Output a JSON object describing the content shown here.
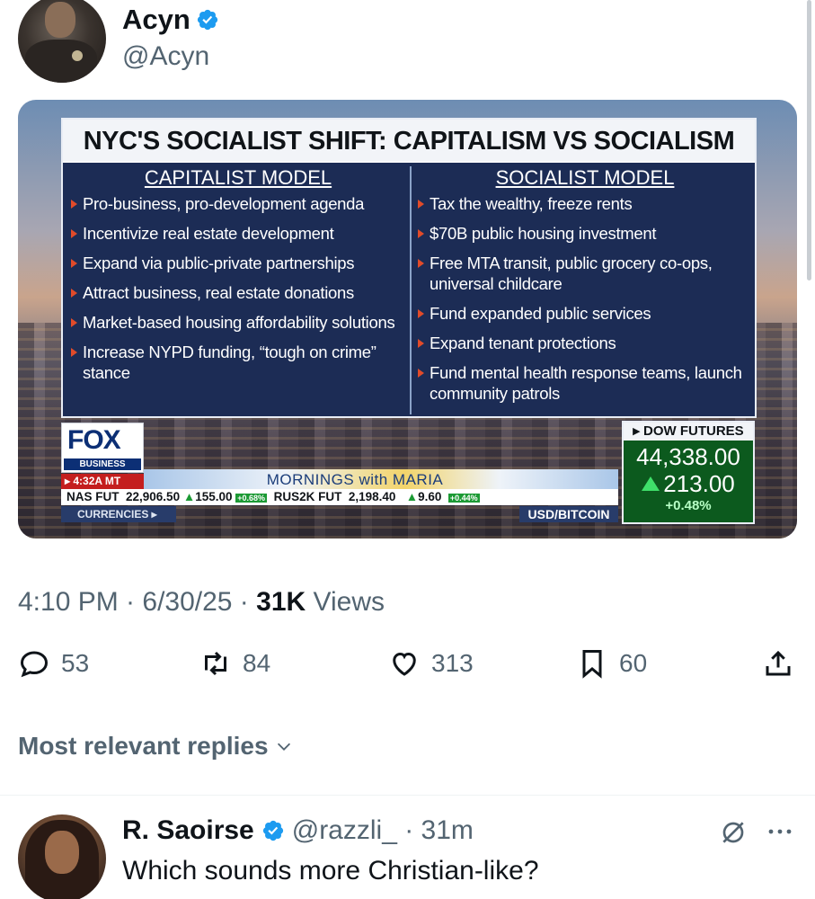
{
  "tweet": {
    "author": {
      "name": "Acyn",
      "handle": "@Acyn"
    },
    "media": {
      "title": "NYC'S SOCIALIST SHIFT: CAPITALISM VS SOCIALISM",
      "left_heading": "CAPITALIST MODEL",
      "left_items": [
        "Pro-business, pro-development agenda",
        "Incentivize real estate development",
        "Expand via public-private partnerships",
        "Attract business, real estate donations",
        "Market-based housing affordability solutions",
        "Increase NYPD funding, “tough on crime” stance"
      ],
      "right_heading": "SOCIALIST MODEL",
      "right_items": [
        "Tax the wealthy, freeze rents",
        "$70B public housing investment",
        "Free MTA transit, public grocery co-ops, universal childcare",
        "Fund expanded public services",
        "Expand tenant protections",
        "Fund mental health response teams, launch community patrols"
      ],
      "network_logo": "FOX",
      "network_sub": "BUSINESS",
      "show_time": "4:32A MT",
      "show_name": "MORNINGS with MARIA",
      "ticker": {
        "nas_label": "NAS FUT",
        "nas_value": "22,906.50",
        "nas_change": "155.00",
        "nas_pct": "+0.68%",
        "rus_label": "RUS2K FUT",
        "rus_value": "2,198.40",
        "rus_change": "9.60",
        "rus_pct": "+0.44%"
      },
      "currencies_label": "CURRENCIES",
      "usd_bitcoin_label": "USD/BITCOIN",
      "dow": {
        "label": "DOW FUTURES",
        "value": "44,338.00",
        "change": "213.00",
        "pct": "+0.48%"
      }
    },
    "timestamp": {
      "time_date": "4:10 PM · 6/30/25 · ",
      "views_count": "31K",
      "views_label": " Views"
    },
    "actions": {
      "replies": "53",
      "reposts": "84",
      "likes": "313",
      "bookmarks": "60"
    },
    "colors": {
      "verified": "#1d9bf0",
      "secondary_text": "#536471"
    }
  },
  "replies_sort": {
    "label": "Most relevant replies"
  },
  "reply": {
    "name": "R. Saoirse",
    "meta": "@razzli_ · 31m",
    "text": "Which sounds more Christian-like?"
  }
}
